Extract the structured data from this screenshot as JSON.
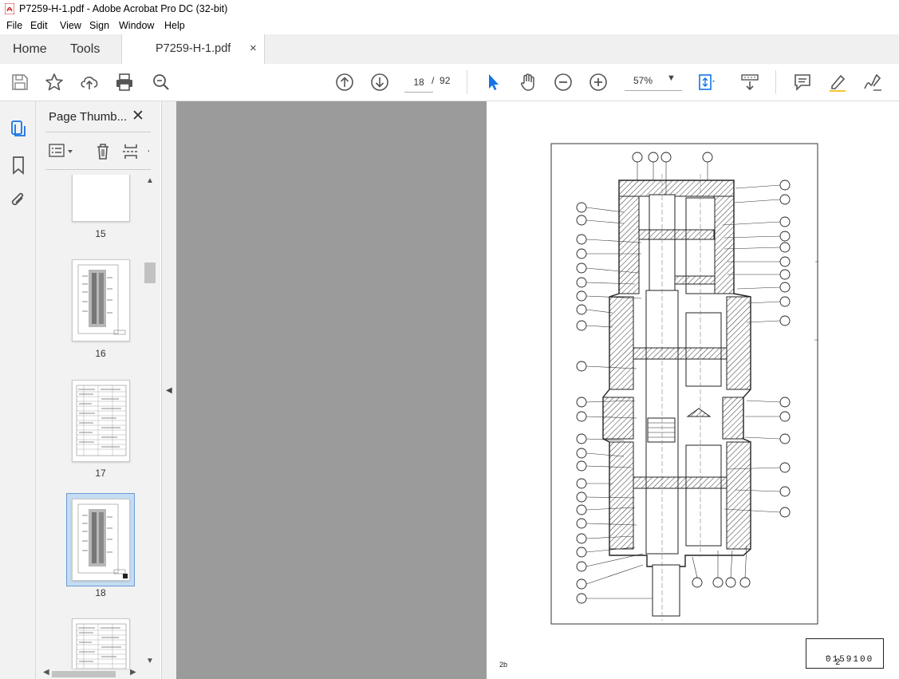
{
  "window": {
    "title": "P7259-H-1.pdf - Adobe Acrobat Pro DC (32-bit)"
  },
  "menu": [
    "File",
    "Edit",
    "View",
    "Sign",
    "Window",
    "Help"
  ],
  "tabs": {
    "home": "Home",
    "tools": "Tools",
    "document": "P7259-H-1.pdf",
    "close": "×"
  },
  "toolbar": {
    "page_current": "18",
    "page_separator": "/",
    "page_total": "92",
    "zoom": "57%",
    "icons": [
      "save-icon",
      "star-icon",
      "upload-icon",
      "print-icon",
      "zoom-search-icon",
      "page-up-icon",
      "page-down-icon",
      "select-pointer-icon",
      "hand-icon",
      "zoom-out-icon",
      "zoom-in-icon",
      "fit-page-icon",
      "scroll-mode-icon",
      "comment-icon",
      "highlight-icon",
      "sign-icon"
    ]
  },
  "side_panel": {
    "title": "Page Thumb...",
    "close": "✕",
    "thumbnails": [
      {
        "label": "15",
        "selected": false
      },
      {
        "label": "16",
        "selected": false
      },
      {
        "label": "17",
        "selected": false
      },
      {
        "label": "18",
        "selected": true
      },
      {
        "label": "",
        "selected": false
      }
    ]
  },
  "document_page": {
    "id_box": "0159100",
    "id_suffix": "2",
    "corner_mark": "2b"
  },
  "colors": {
    "accent": "#1473e6",
    "selected_thumb_bg": "#c5dcf2",
    "doc_bg": "#9b9b9b"
  }
}
